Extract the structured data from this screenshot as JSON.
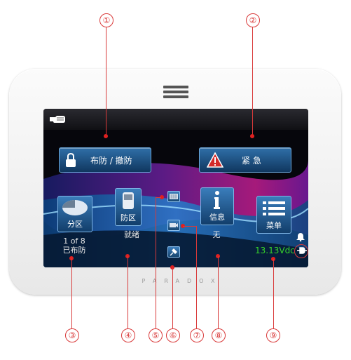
{
  "callouts": [
    "①",
    "②",
    "③",
    "④",
    "⑤",
    "⑥",
    "⑦",
    "⑧",
    "⑨"
  ],
  "brand": "PARADOX",
  "screen": {
    "arm_disarm_button": "布防 / 撤防",
    "emergency_button": "紧 急",
    "area_tile": {
      "label": "分区",
      "status_line1": "1 of 8",
      "status_line2": "已布防"
    },
    "zone_tile": {
      "label": "防区",
      "status": "就绪"
    },
    "info_tile": {
      "label": "信息",
      "status": "无"
    },
    "menu_tile": {
      "label": "菜单"
    },
    "voltage": "13.13Vdc"
  },
  "colors": {
    "callout": "#d93a3a",
    "button_blue": "#1f5a92",
    "voltage_green": "#36d22a",
    "warning_red": "#d42a2a"
  },
  "icons": [
    "hand-icon",
    "lock-icon",
    "warning-icon",
    "pie-chart-icon",
    "keypad-icon",
    "info-icon",
    "list-icon",
    "keyboard-icon",
    "camera-icon",
    "pin-icon",
    "bell-icon",
    "power-plug-icon"
  ]
}
